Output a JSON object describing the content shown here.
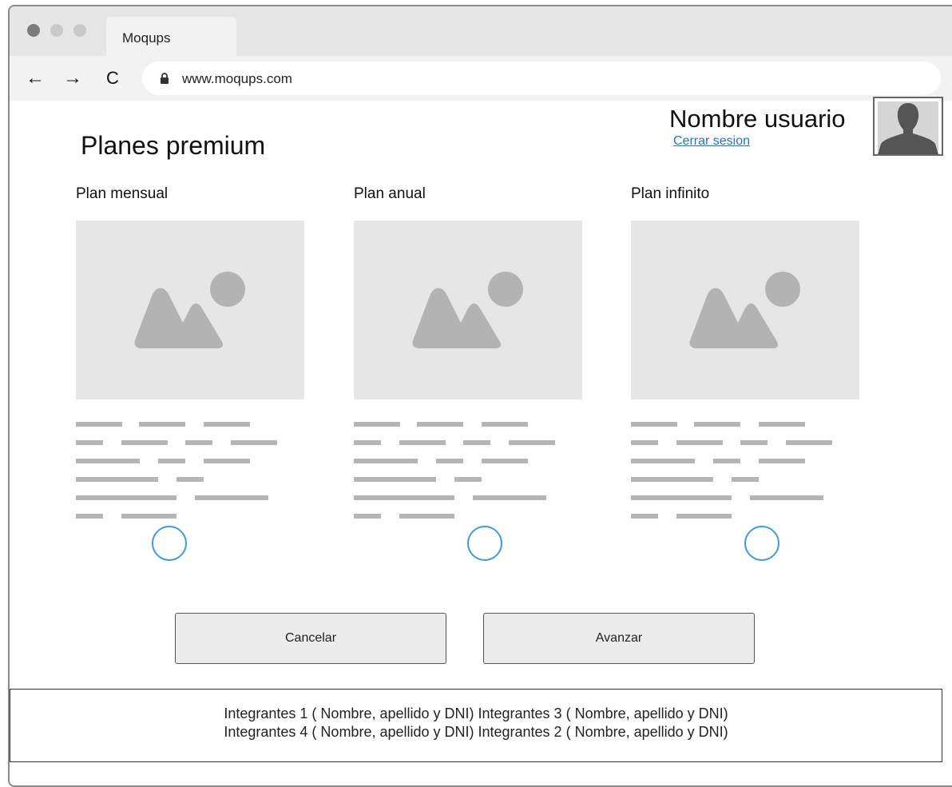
{
  "browser": {
    "tab_title": "Moqups",
    "url": "www.moqups.com",
    "nav": {
      "back": "←",
      "forward": "→",
      "reload": "C"
    }
  },
  "header": {
    "page_title": "Planes premium",
    "user_name": "Nombre usuario",
    "logout_label": "Cerrar sesion"
  },
  "plans": [
    {
      "name": "Plan mensual"
    },
    {
      "name": "Plan anual"
    },
    {
      "name": "Plan infinito"
    }
  ],
  "actions": {
    "cancel_label": "Cancelar",
    "next_label": "Avanzar"
  },
  "footer": {
    "line1": "Integrantes 1 ( Nombre, apellido y DNI) Integrantes 3 ( Nombre, apellido y DNI)",
    "line2": "Integrantes 4 ( Nombre, apellido y DNI) Integrantes 2 ( Nombre, apellido y DNI)"
  },
  "colors": {
    "link": "#1e74d3",
    "radio_border": "#3b9ae6",
    "placeholder_bg": "#e6e6e6",
    "placeholder_shape": "#b3b3b3",
    "avatar_silhouette": "#555555"
  },
  "icons": {
    "lock": "lock-icon",
    "image_placeholder": "image-placeholder-icon",
    "avatar": "user-silhouette-icon"
  }
}
